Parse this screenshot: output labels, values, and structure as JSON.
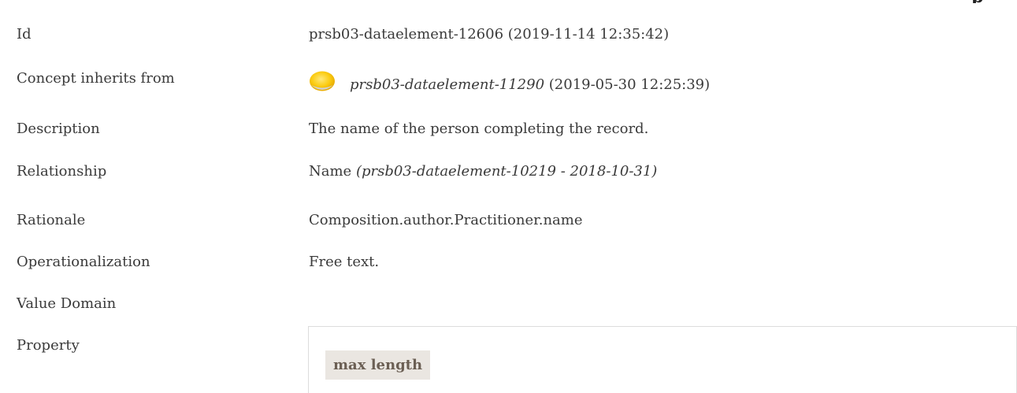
{
  "rows": {
    "id": {
      "label": "Id",
      "value": "prsb03-dataelement-12606 (2019-11-14 12:35:42)"
    },
    "concept_inherits_from": {
      "label": "Concept inherits from",
      "link": "prsb03-dataelement-11290",
      "date": " (2019-05-30 12:25:39)",
      "icon": "status-bulb-icon",
      "icon_color": "#f7c600"
    },
    "description": {
      "label": "Description",
      "value": "The name of the person completing the record."
    },
    "relationship": {
      "label": "Relationship",
      "name": "Name ",
      "ref": "(prsb03-dataelement-10219 - 2018-10-31)"
    },
    "rationale": {
      "label": "Rationale",
      "value": "Composition.author.Practitioner.name"
    },
    "operationalization": {
      "label": "Operationalization",
      "value": "Free text."
    },
    "value_domain": {
      "label": "Value Domain"
    },
    "property": {
      "label": "Property",
      "header": "max length"
    }
  }
}
